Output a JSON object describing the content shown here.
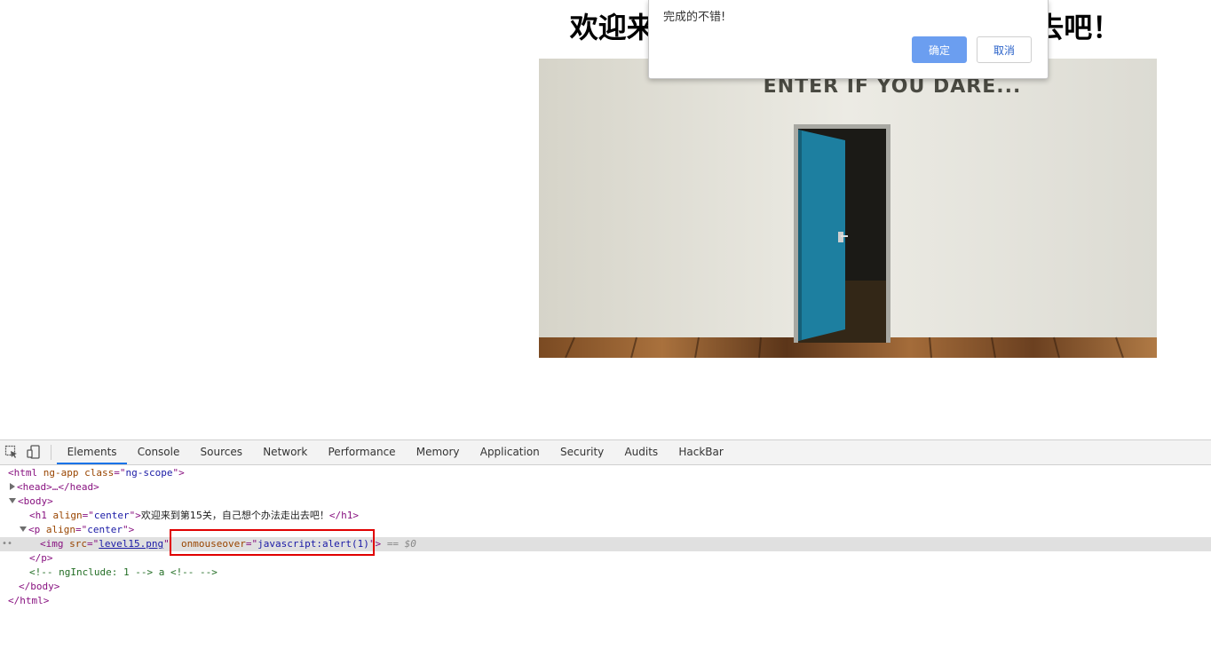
{
  "page": {
    "heading": "欢迎来到第15关，自己想个办法走出去吧！",
    "image_text": "ENTER IF YOU DARE..."
  },
  "dialog": {
    "message": "完成的不错!",
    "ok_label": "确定",
    "cancel_label": "取消"
  },
  "devtools": {
    "tabs": [
      "Elements",
      "Console",
      "Sources",
      "Network",
      "Performance",
      "Memory",
      "Application",
      "Security",
      "Audits",
      "HackBar"
    ],
    "active_tab": "Elements",
    "dom": {
      "html_open_tag": "html",
      "html_attr_name": "ng-app",
      "html_attr2_name": "class",
      "html_attr2_value": "ng-scope",
      "head": "<head>…</head>",
      "body_open": "<body>",
      "h1_attr_name": "align",
      "h1_attr_value": "center",
      "h1_text": "欢迎来到第15关，自己想个办法走出去吧！",
      "h1_close": "</h1>",
      "p_attr_name": "align",
      "p_attr_value": "center",
      "img_src_name": "src",
      "img_src_value": "level15.png",
      "img_event_name": "onmouseover",
      "img_event_value": "javascript:alert(1)",
      "selected_marker": "== $0",
      "p_close": "</p>",
      "comment": "<!-- ngInclude: 1 --> a <!-- -->",
      "body_close": "</body>",
      "html_close": "</html>"
    }
  },
  "colors": {
    "accent": "#1a73e8",
    "ok_button": "#6b9ef0",
    "highlight": "#e00000",
    "door": "#1d7fa0"
  }
}
